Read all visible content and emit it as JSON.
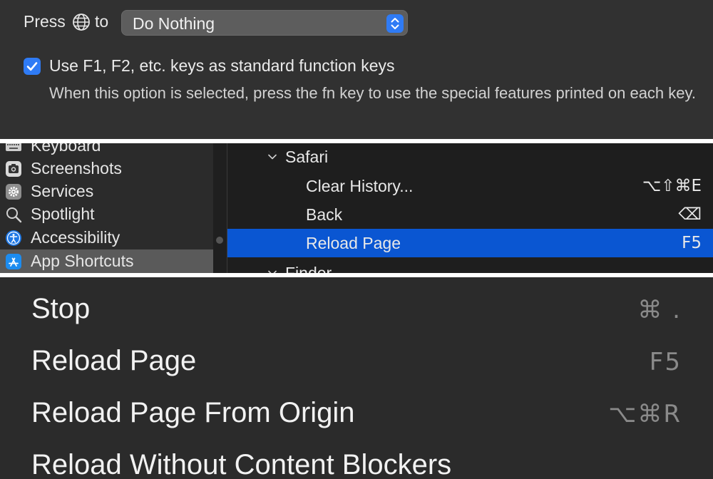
{
  "keyboard_prefs": {
    "press_label": "Press",
    "to_label": "to",
    "globe_icon": "globe-icon",
    "popup_value": "Do Nothing",
    "function_keys_checkbox": {
      "checked": true,
      "label": "Use F1, F2, etc. keys as standard function keys",
      "description": "When this option is selected, press the fn key to use the special features printed on each key."
    }
  },
  "shortcuts_pane": {
    "sidebar": {
      "items": [
        {
          "label": "Keyboard",
          "icon": "keyboard-icon"
        },
        {
          "label": "Screenshots",
          "icon": "screenshots-icon"
        },
        {
          "label": "Services",
          "icon": "services-gear-icon"
        },
        {
          "label": "Spotlight",
          "icon": "spotlight-search-icon"
        },
        {
          "label": "Accessibility",
          "icon": "accessibility-icon"
        },
        {
          "label": "App Shortcuts",
          "icon": "app-store-icon",
          "selected": true
        }
      ]
    },
    "rows": [
      {
        "type": "group",
        "label": "Safari"
      },
      {
        "type": "item",
        "label": "Clear History...",
        "key": "⌥⇧⌘E"
      },
      {
        "type": "item",
        "label": "Back",
        "key": "⌫"
      },
      {
        "type": "item",
        "label": "Reload Page",
        "key": "F5",
        "selected": true
      },
      {
        "type": "group",
        "label": "Finder"
      }
    ],
    "selection_color": "#0a56d2"
  },
  "safari_menu": {
    "items": [
      {
        "label": "Stop",
        "key": "⌘ ."
      },
      {
        "label": "Reload Page",
        "key": "F5"
      },
      {
        "label": "Reload Page From Origin",
        "key": "⌥⌘R"
      },
      {
        "label": "Reload Without Content Blockers",
        "key": ""
      }
    ]
  },
  "colors": {
    "accent": "#2f7bf5",
    "panel_bg": "#313131",
    "menu_bg": "#2b2b2b"
  }
}
